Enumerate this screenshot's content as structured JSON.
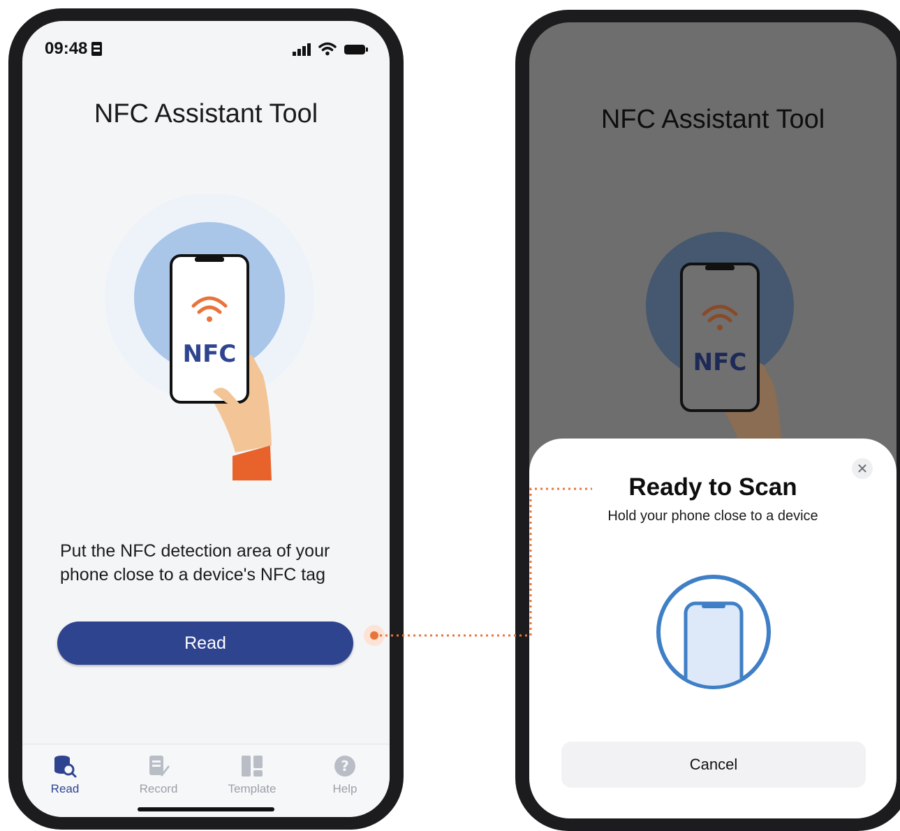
{
  "left_phone": {
    "status_bar": {
      "time": "09:48",
      "icons": [
        "sim-card-icon",
        "signal-icon",
        "wifi-icon",
        "battery-icon"
      ]
    },
    "title": "NFC Assistant Tool",
    "illustration": {
      "badge_text": "NFC",
      "icons": [
        "nfc-wave-icon",
        "hand-icon"
      ]
    },
    "instruction": "Put the NFC detection area of your phone close to a device's NFC tag",
    "read_button": "Read",
    "tabs": [
      {
        "label": "Read",
        "icon": "read-database-icon",
        "active": true
      },
      {
        "label": "Record",
        "icon": "record-edit-icon",
        "active": false
      },
      {
        "label": "Template",
        "icon": "template-grid-icon",
        "active": false
      },
      {
        "label": "Help",
        "icon": "help-question-icon",
        "active": false
      }
    ]
  },
  "right_phone": {
    "title": "NFC Assistant Tool",
    "illustration": {
      "badge_text": "NFC"
    },
    "scan_sheet": {
      "title": "Ready to Scan",
      "subtitle": "Hold your phone close to a device",
      "close_icon": "close-icon",
      "graphic_icon": "phone-scan-icon",
      "cancel_button": "Cancel"
    }
  },
  "colors": {
    "primary_blue": "#2f448f",
    "accent_orange": "#e8743b",
    "circle_blue": "#a9c6e9",
    "scan_blue": "#3f7fc6",
    "frame": "#1c1c1e"
  }
}
